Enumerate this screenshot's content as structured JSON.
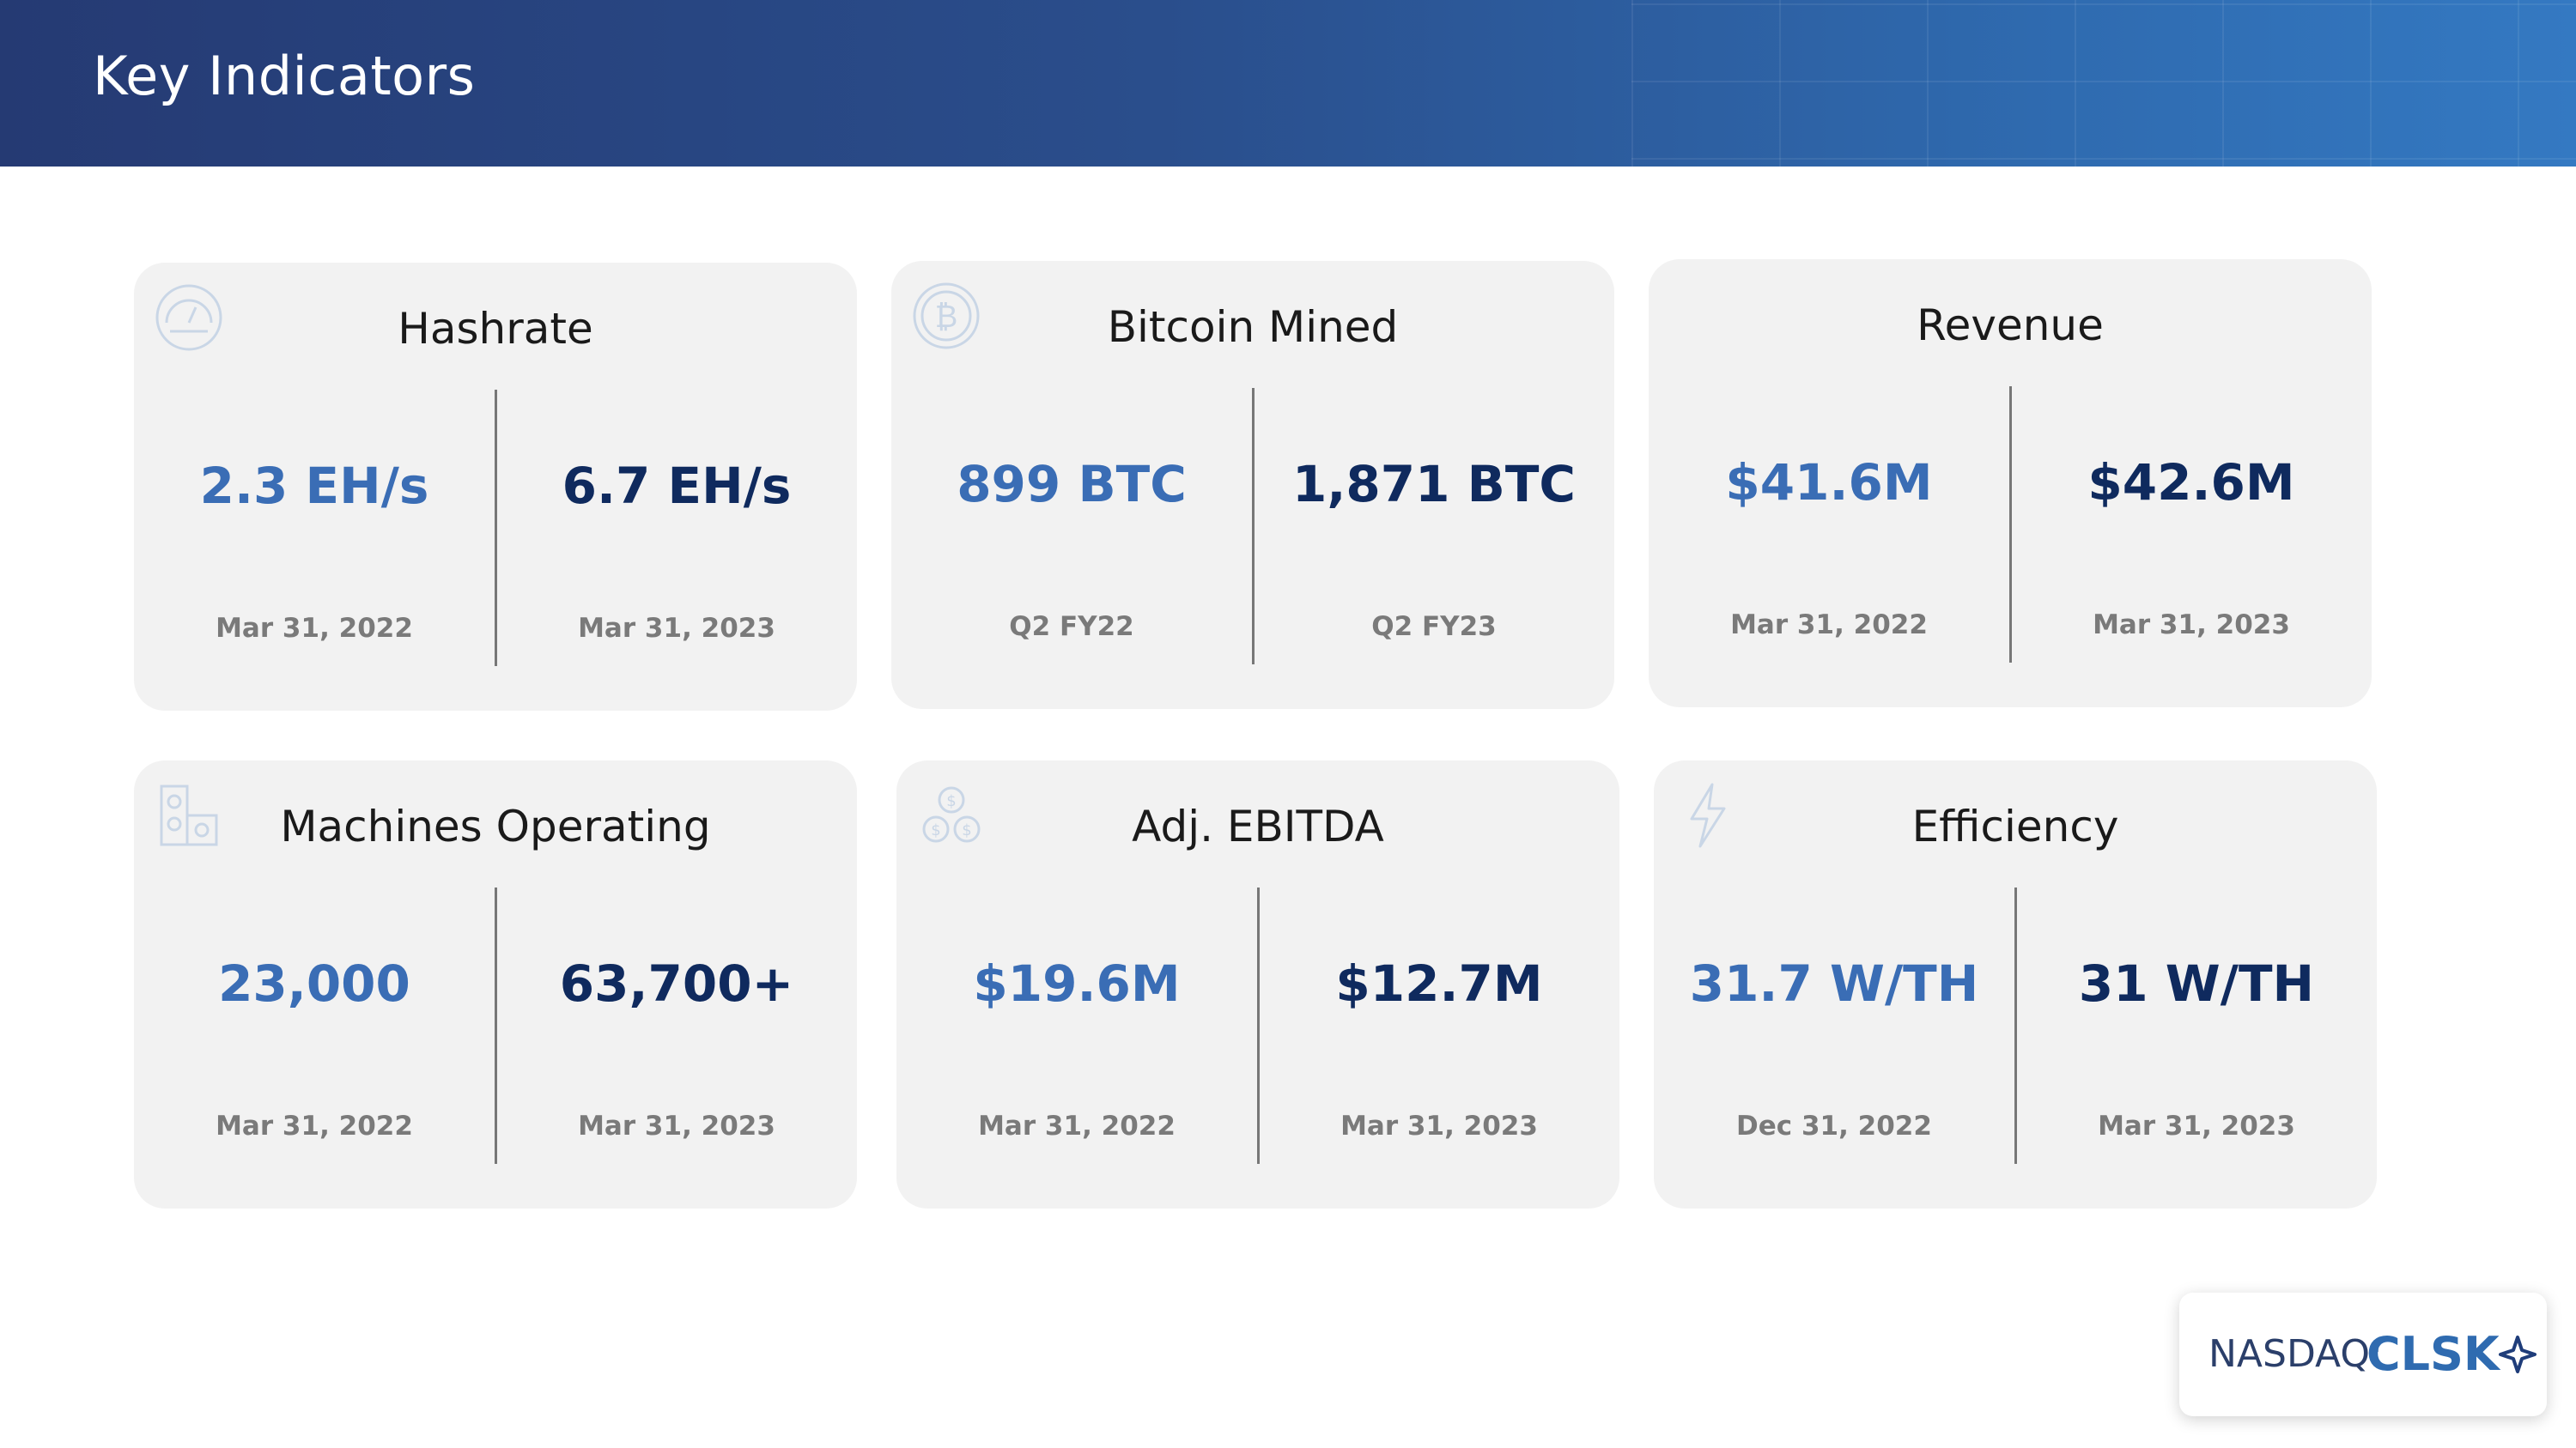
{
  "header": {
    "title": "Key Indicators"
  },
  "cards": [
    {
      "title": "Hashrate",
      "icon": "speedometer-icon",
      "left_value": "2.3 EH/s",
      "left_date": "Mar 31, 2022",
      "right_value": "6.7 EH/s",
      "right_date": "Mar  31, 2023"
    },
    {
      "title": "Bitcoin Mined",
      "icon": "bitcoin-icon",
      "left_value": "899 BTC",
      "left_date": "Q2 FY22",
      "right_value": "1,871 BTC",
      "right_date": "Q2 FY23"
    },
    {
      "title": "Revenue",
      "icon": "",
      "left_value": "$41.6M",
      "left_date": "Mar  31, 2022",
      "right_value": "$42.6M",
      "right_date": "Mar  31, 2023"
    },
    {
      "title": "Machines Operating",
      "icon": "mining-machines-icon",
      "left_value": "23,000",
      "left_date": "Mar 31, 2022",
      "right_value": "63,700+",
      "right_date": "Mar  31, 2023"
    },
    {
      "title": "Adj. EBITDA",
      "icon": "coins-icon",
      "left_value": "$19.6M",
      "left_date": "Mar 31, 2022",
      "right_value": "$12.7M",
      "right_date": "Mar 31, 2023"
    },
    {
      "title": "Efficiency",
      "icon": "lightning-icon",
      "left_value": "31.7 W/TH",
      "left_date": "Dec 31, 2022",
      "right_value": "31 W/TH",
      "right_date": "Mar 31, 2023"
    }
  ],
  "badge": {
    "exchange": "NASDAQ:",
    "ticker": "CLSK",
    "icon": "cleanspark-star-icon"
  },
  "colors": {
    "header_start": "#253a73",
    "header_end": "#3479c2",
    "previous_value": "#3a6db5",
    "current_value": "#0f2a5e",
    "card_bg": "#f2f2f2"
  }
}
